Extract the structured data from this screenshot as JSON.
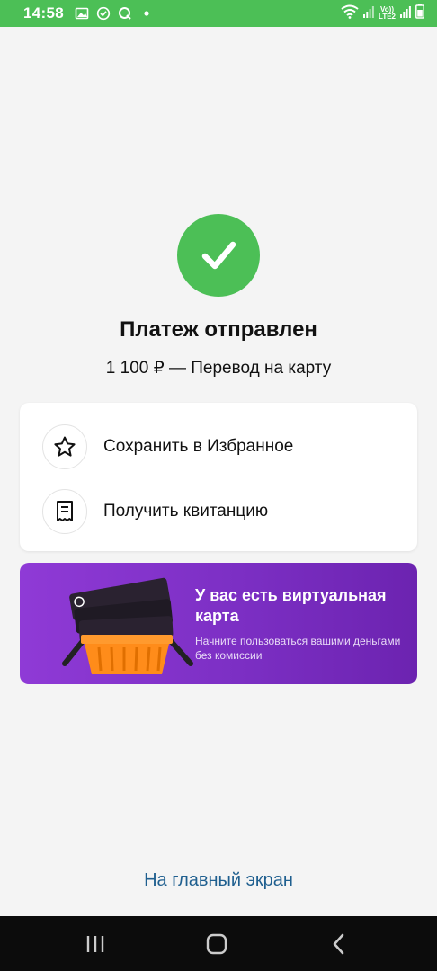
{
  "status_bar": {
    "time": "14:58",
    "network_top": "Vo))",
    "network_bottom": "LTE2",
    "icons": [
      "gallery-icon",
      "check-circle-icon",
      "qiwi-icon",
      "dot-icon",
      "wifi-icon",
      "signal-icon",
      "battery-icon"
    ]
  },
  "success": {
    "icon": "checkmark-icon",
    "title": "Платеж отправлен",
    "subtitle": "1 100 ₽ — Перевод на карту"
  },
  "actions": [
    {
      "icon": "star-icon",
      "label": "Сохранить в Избранное"
    },
    {
      "icon": "receipt-icon",
      "label": "Получить квитанцию"
    }
  ],
  "promo": {
    "title": "У вас есть виртуальная карта",
    "text": "Начните пользоваться вашими деньгами без комиссии",
    "image": "cards-in-basket-illustration"
  },
  "home_link": "На главный экран",
  "nav_bar": {
    "buttons": [
      "recent-apps-icon",
      "home-icon",
      "back-icon"
    ]
  },
  "colors": {
    "accent_green": "#4cbf56",
    "background": "#f4f4f4",
    "link_blue": "#1f5f8f",
    "promo_purple": "#8f3ad6"
  }
}
